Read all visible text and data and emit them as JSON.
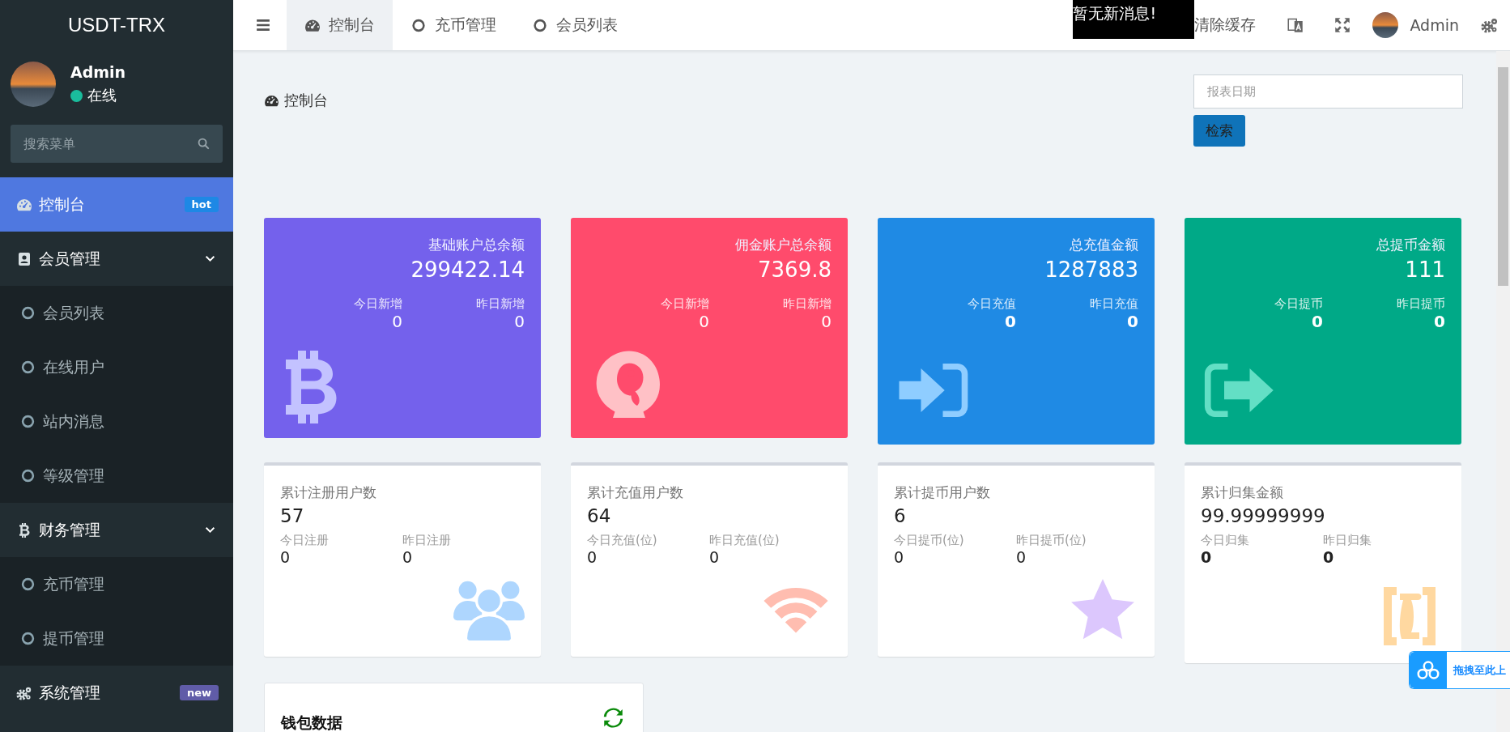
{
  "sidebar": {
    "brand": "USDT-TRX",
    "user": {
      "name": "Admin",
      "status": "在线"
    },
    "search": {
      "placeholder": "搜索菜单"
    },
    "menu": [
      {
        "label": "控制台",
        "selected": true,
        "badge": {
          "text": "hot",
          "color": "#1e88e5"
        }
      },
      {
        "label": "会员管理",
        "selected": false,
        "expanded": true,
        "children": [
          {
            "label": "会员列表"
          },
          {
            "label": "在线用户"
          },
          {
            "label": "站内消息"
          },
          {
            "label": "等级管理"
          }
        ]
      },
      {
        "label": "财务管理",
        "selected": false,
        "expanded": true,
        "children": [
          {
            "label": "充币管理"
          },
          {
            "label": "提币管理"
          }
        ]
      },
      {
        "label": "系统管理",
        "selected": false,
        "badge": {
          "text": "new",
          "color": "#605ca8"
        }
      }
    ]
  },
  "topbar": {
    "tabs": [
      {
        "label": "控制台",
        "selected": true
      },
      {
        "label": "充币管理",
        "selected": false
      },
      {
        "label": "会员列表",
        "selected": false
      }
    ],
    "notice": "暂无新消息!",
    "clear_cache": "清除缓存",
    "user": "Admin"
  },
  "content": {
    "breadcrumb": "控制台",
    "date_field": {
      "placeholder": "报表日期"
    },
    "search_button": "检索",
    "stat_cards": [
      {
        "title": "基础账户总余额",
        "value": "299422.14",
        "color": "#7461ec",
        "stats": [
          {
            "label": "今日新增",
            "value": "0"
          },
          {
            "label": "昨日新增",
            "value": "0"
          }
        ]
      },
      {
        "title": "佣金账户总余额",
        "value": "7369.8",
        "color": "#ff4b6c",
        "stats": [
          {
            "label": "今日新增",
            "value": "0"
          },
          {
            "label": "昨日新增",
            "value": "0"
          }
        ]
      },
      {
        "title": "总充值金额",
        "value": "1287883",
        "color": "#1f8ae4",
        "stats": [
          {
            "label": "今日充值",
            "value": "0"
          },
          {
            "label": "昨日充值",
            "value": "0"
          }
        ]
      },
      {
        "title": "总提币金额",
        "value": "111",
        "color": "#00a987",
        "stats": [
          {
            "label": "今日提币",
            "value": "0"
          },
          {
            "label": "昨日提币",
            "value": "0"
          }
        ]
      }
    ],
    "info_cards": [
      {
        "title": "累计注册用户数",
        "value": "57",
        "color": "#aed6fe",
        "stats": [
          {
            "label": "今日注册",
            "value": "0"
          },
          {
            "label": "昨日注册",
            "value": "0"
          }
        ]
      },
      {
        "title": "累计充值用户数",
        "value": "64",
        "color": "#ffbdb0",
        "stats": [
          {
            "label": "今日充值(位)",
            "value": "0"
          },
          {
            "label": "昨日充值(位)",
            "value": "0"
          }
        ]
      },
      {
        "title": "累计提币用户数",
        "value": "6",
        "color": "#dcc7fd",
        "stats": [
          {
            "label": "今日提币(位)",
            "value": "0"
          },
          {
            "label": "昨日提币(位)",
            "value": "0"
          }
        ]
      },
      {
        "title": "累计归集金额",
        "value": "99.99999999",
        "color": "#ffd8a0",
        "stats": [
          {
            "label": "今日归集",
            "value": "0"
          },
          {
            "label": "昨日归集",
            "value": "0"
          }
        ]
      }
    ],
    "wallet_panel": {
      "title": "钱包数据"
    }
  },
  "drop_widget": {
    "label": "拖拽至此上"
  }
}
